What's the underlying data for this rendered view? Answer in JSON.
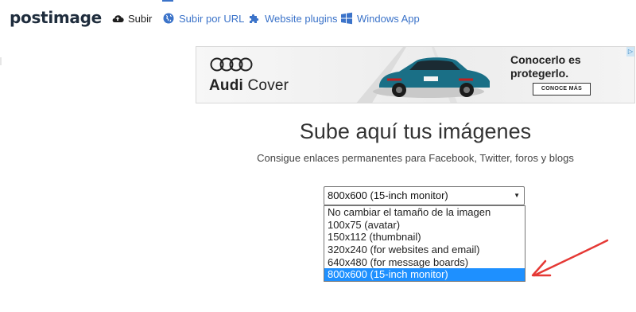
{
  "nav": {
    "logo": "postimage",
    "items": [
      {
        "label": "Subir",
        "icon": "cloud-upload-icon"
      },
      {
        "label": "Subir por URL",
        "icon": "globe-icon"
      },
      {
        "label": "Website plugins",
        "icon": "puzzle-icon"
      },
      {
        "label": "Windows App",
        "icon": "windows-icon"
      }
    ]
  },
  "ad": {
    "brand_prefix": "Audi",
    "brand_suffix": "Cover",
    "headline": "Conocerlo es protegerlo.",
    "cta": "CONOCE MÁS"
  },
  "main": {
    "title": "Sube aquí tus imágenes",
    "subtitle": "Consigue enlaces permanentes para Facebook, Twitter, foros y blogs"
  },
  "resize": {
    "selected": "800x600 (15-inch monitor)",
    "options": [
      "No cambiar el tamaño de la imagen",
      "100x75 (avatar)",
      "150x112 (thumbnail)",
      "320x240 (for websites and email)",
      "640x480 (for message boards)",
      "800x600 (15-inch monitor)"
    ],
    "highlight_color": "#1e90ff"
  },
  "annotation": {
    "color": "#e53935"
  }
}
